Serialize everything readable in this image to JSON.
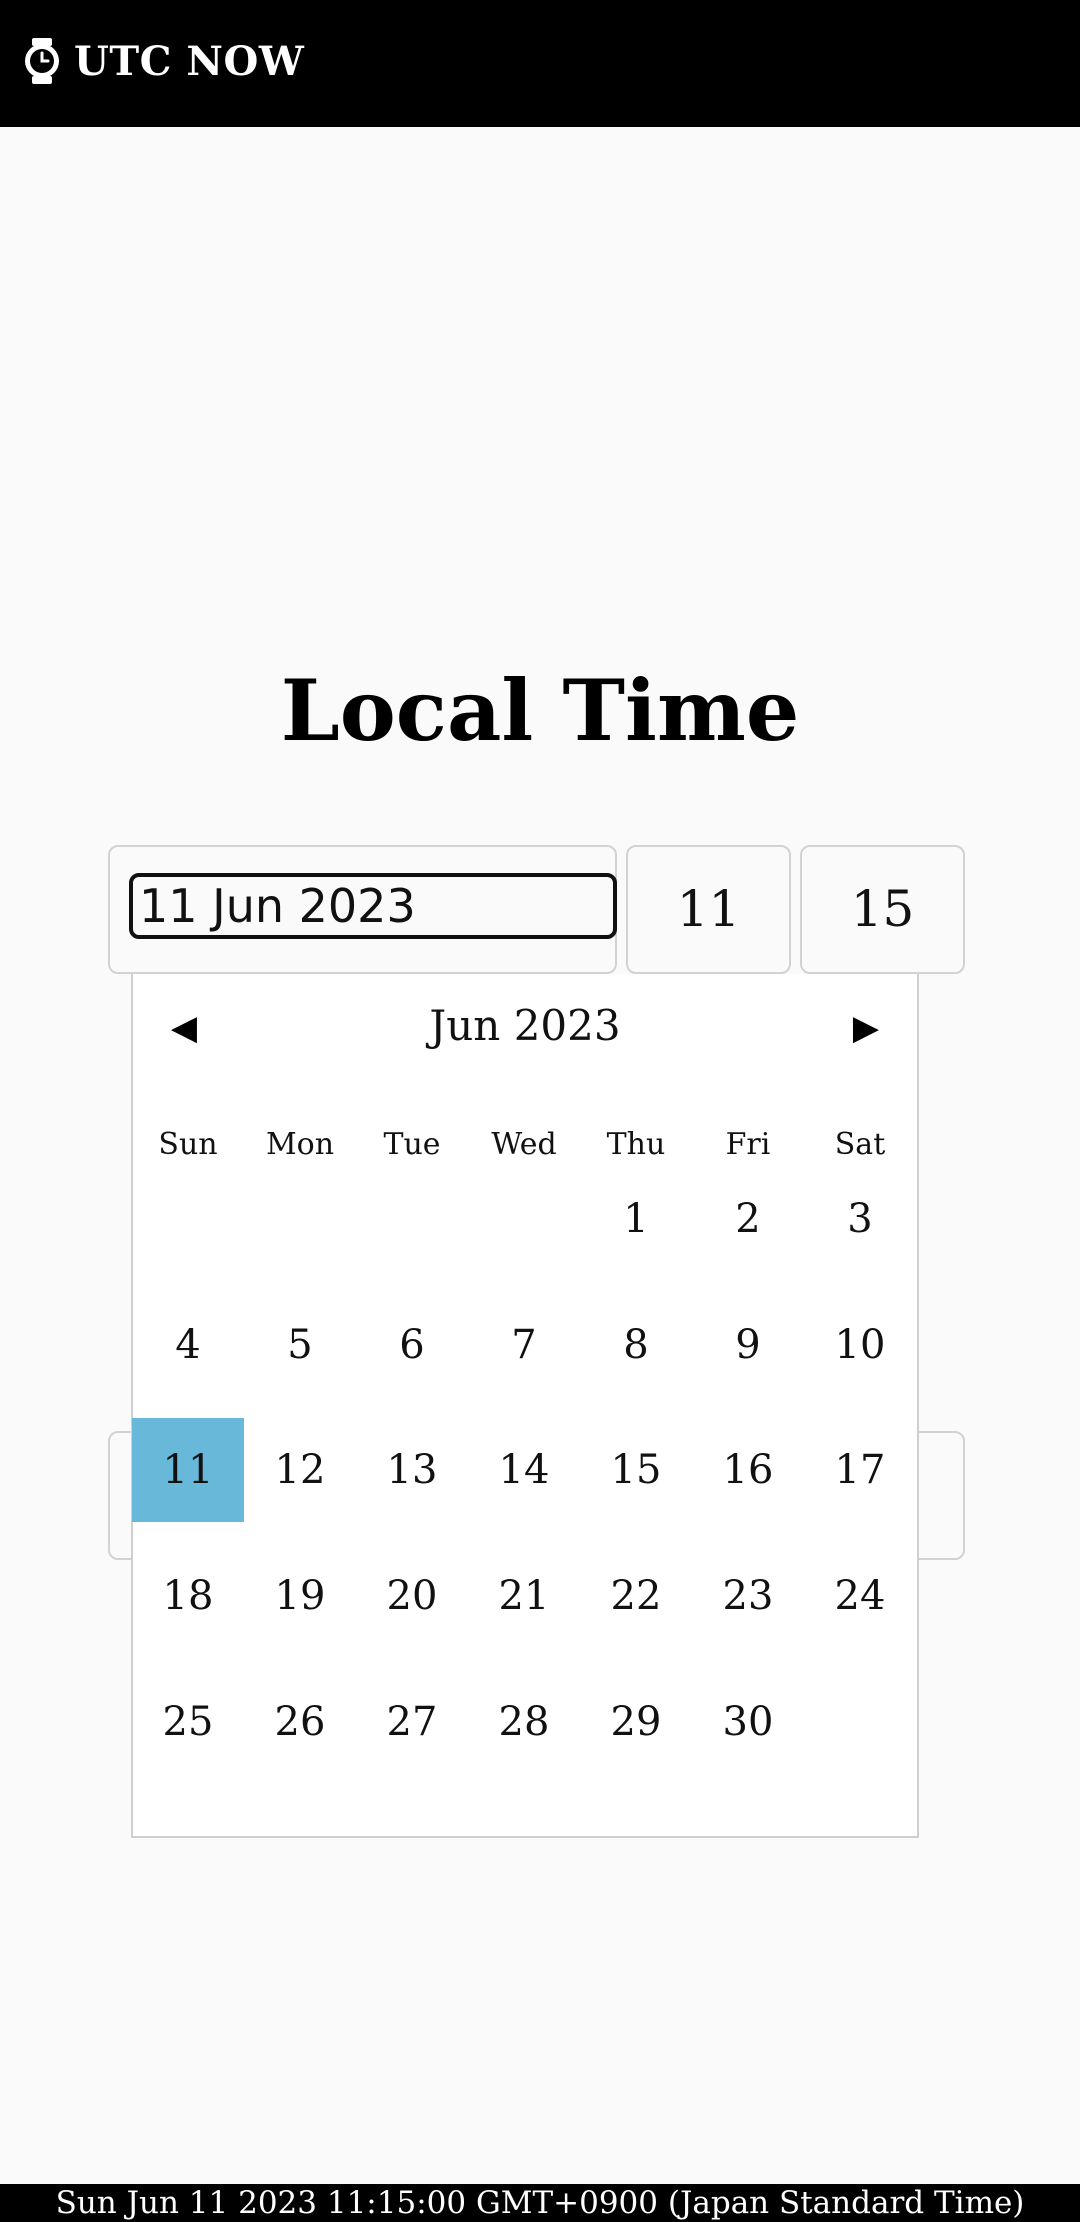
{
  "app": {
    "title": "UTC NOW",
    "icon": "watch-icon"
  },
  "main": {
    "heading": "Local Time",
    "date_value": "11 Jun 2023",
    "hour_value": "11",
    "minute_value": "15"
  },
  "calendar": {
    "month_label": "Jun 2023",
    "prev_icon": "◀",
    "next_icon": "▶",
    "weekdays": [
      "Sun",
      "Mon",
      "Tue",
      "Wed",
      "Thu",
      "Fri",
      "Sat"
    ],
    "days": [
      "1",
      "2",
      "3",
      "4",
      "5",
      "6",
      "7",
      "8",
      "9",
      "10",
      "11",
      "12",
      "13",
      "14",
      "15",
      "16",
      "17",
      "18",
      "19",
      "20",
      "21",
      "22",
      "23",
      "24",
      "25",
      "26",
      "27",
      "28",
      "29",
      "30"
    ],
    "first_weekday_index": 4,
    "selected_day": "11",
    "selected_color": "#68b8da"
  },
  "footer": {
    "status_text": "Sun Jun 11 2023 11:15:00 GMT+0900 (Japan Standard Time)"
  }
}
